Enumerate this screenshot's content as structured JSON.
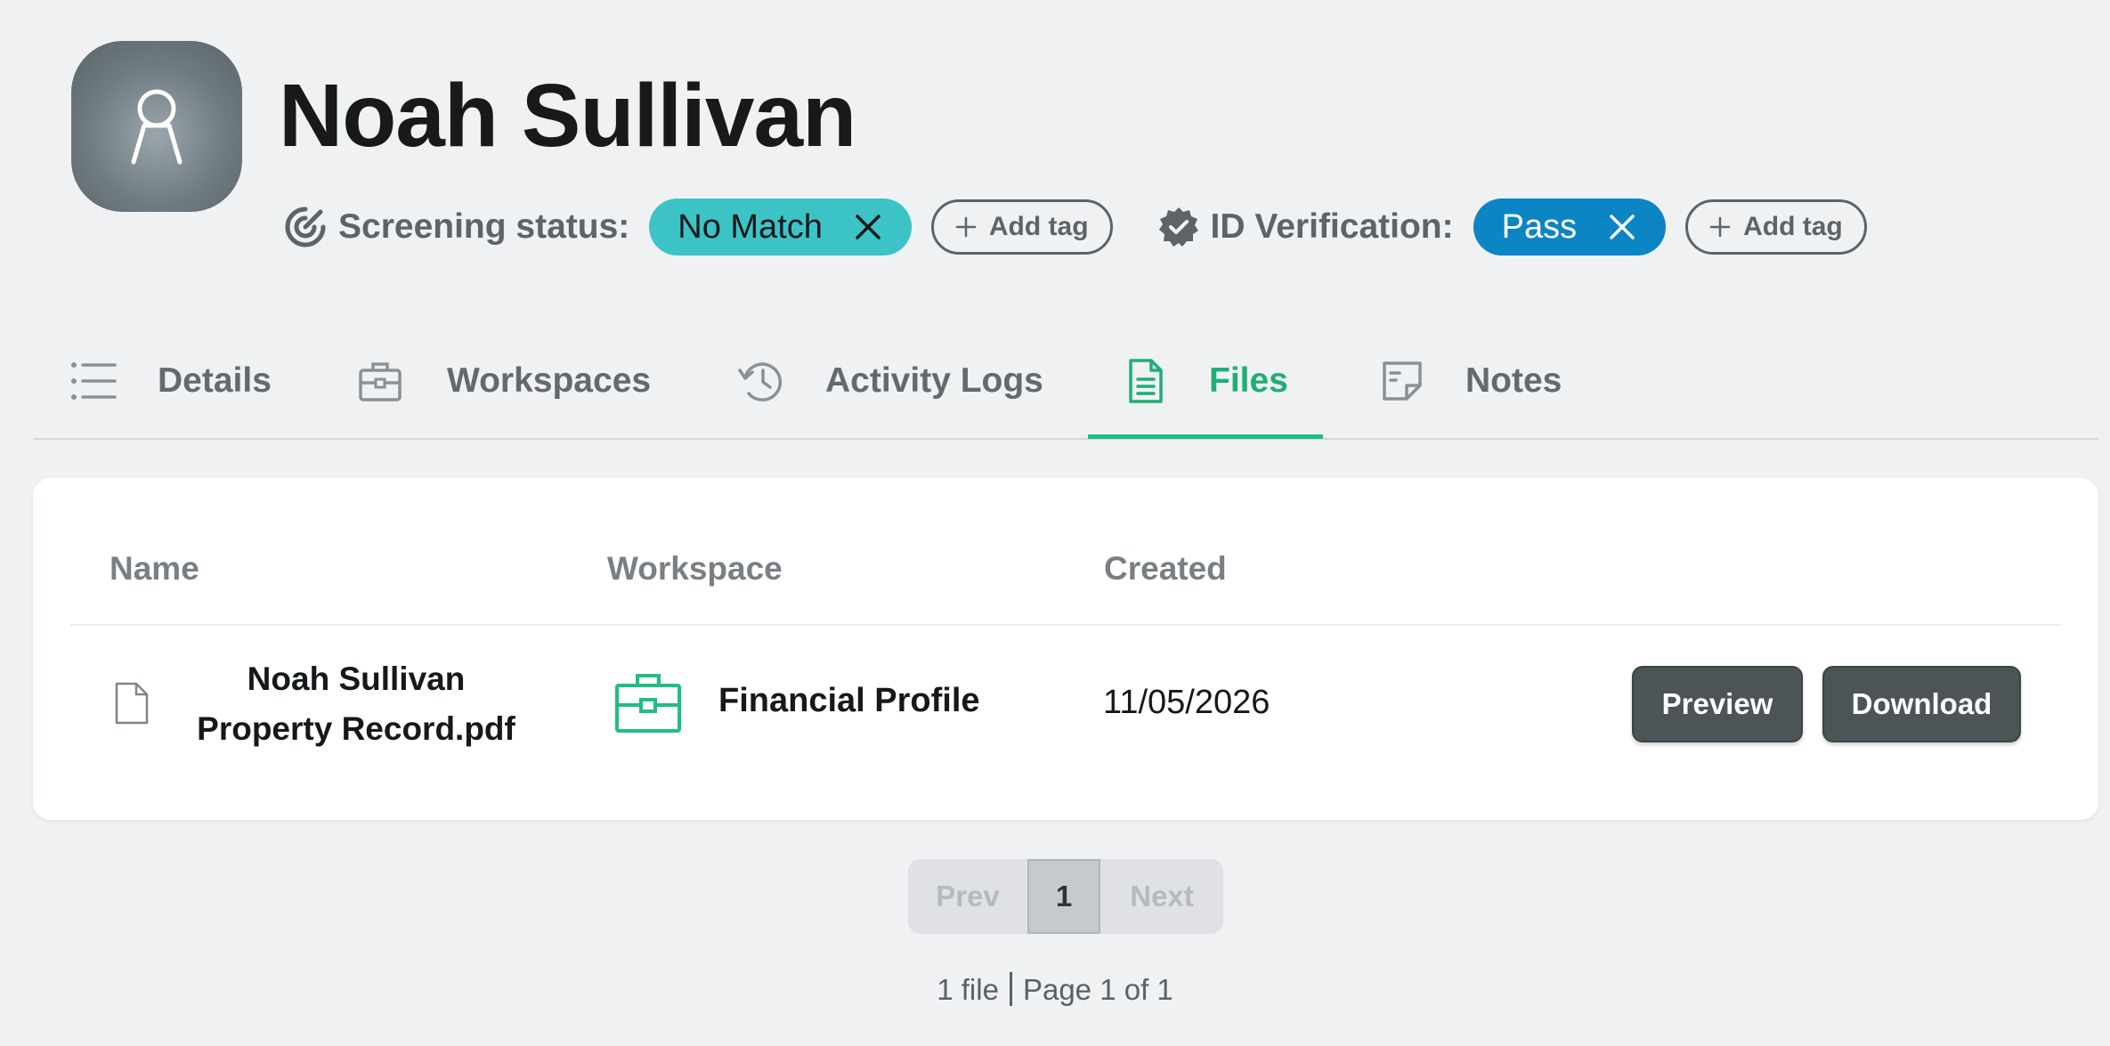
{
  "profile": {
    "name": "Noah Sullivan"
  },
  "tags": {
    "screening": {
      "label": "Screening status:",
      "value": "No Match",
      "add_label": "Add tag",
      "color": "#3cc3c5"
    },
    "id_verification": {
      "label": "ID Verification:",
      "value": "Pass",
      "add_label": "Add tag",
      "color": "#0b85c4"
    }
  },
  "tabs": [
    {
      "label": "Details",
      "icon": "list-icon",
      "active": false
    },
    {
      "label": "Workspaces",
      "icon": "briefcase-icon",
      "active": false
    },
    {
      "label": "Activity Logs",
      "icon": "history-icon",
      "active": false
    },
    {
      "label": "Files",
      "icon": "file-icon",
      "active": true
    },
    {
      "label": "Notes",
      "icon": "note-icon",
      "active": false
    }
  ],
  "table": {
    "headers": {
      "name": "Name",
      "workspace": "Workspace",
      "created": "Created"
    },
    "rows": [
      {
        "name_line1": "Noah Sullivan",
        "name_line2": "Property Record.pdf",
        "workspace": "Financial Profile",
        "created": "11/05/2026",
        "preview_label": "Preview",
        "download_label": "Download"
      }
    ]
  },
  "pagination": {
    "prev_label": "Prev",
    "current_page": "1",
    "next_label": "Next",
    "file_count": "1 file",
    "page_info": "Page 1 of 1"
  },
  "colors": {
    "accent": "#1fbf82",
    "button": "#4c5458",
    "background": "#eff1f3"
  }
}
